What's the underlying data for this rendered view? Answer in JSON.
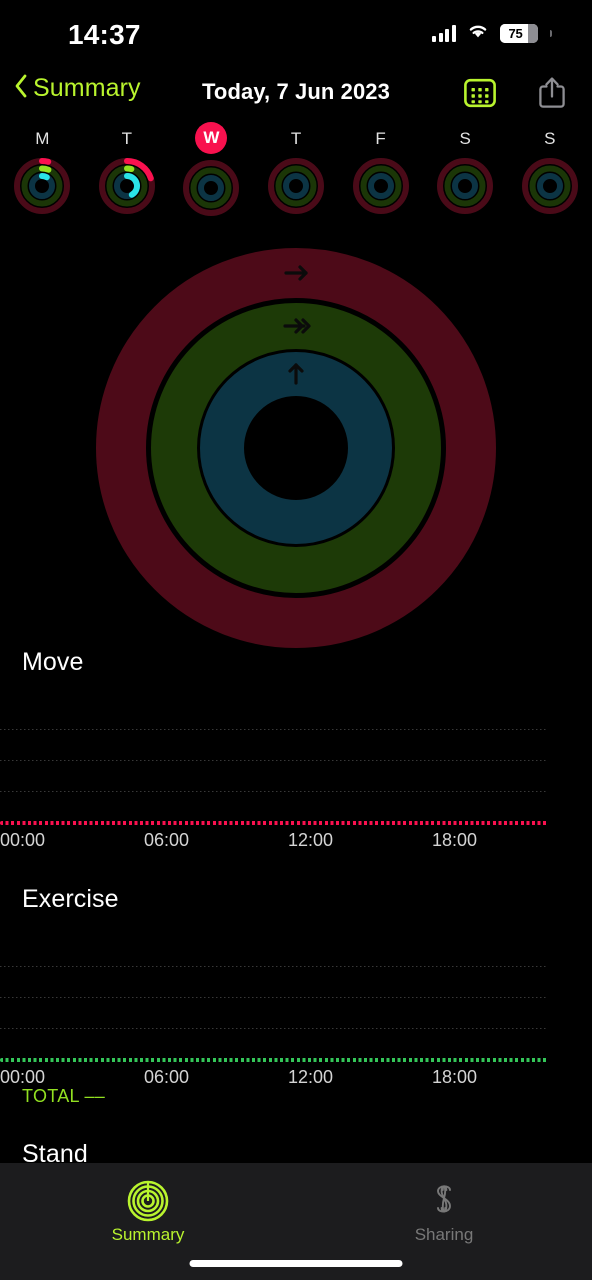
{
  "status_bar": {
    "time": "14:37",
    "cellular_icon": "cellular-bars-icon",
    "wifi_icon": "wifi-icon",
    "battery_level": "75",
    "battery_percent": 75
  },
  "nav_bar": {
    "back_icon": "chevron-left-icon",
    "back_label": "Summary",
    "title": "Today, 7 Jun 2023",
    "calendar_icon": "calendar-icon",
    "share_icon": "share-icon"
  },
  "week_strip": {
    "days": [
      {
        "label": "M",
        "is_today": false,
        "move_pct": 4,
        "exercise_pct": 6,
        "stand_pct": 8
      },
      {
        "label": "T",
        "is_today": false,
        "move_pct": 20,
        "exercise_pct": 4,
        "stand_pct": 42
      },
      {
        "label": "W",
        "is_today": true,
        "move_pct": 0,
        "exercise_pct": 0,
        "stand_pct": 0
      },
      {
        "label": "T",
        "is_today": false,
        "move_pct": 0,
        "exercise_pct": 0,
        "stand_pct": 0
      },
      {
        "label": "F",
        "is_today": false,
        "move_pct": 0,
        "exercise_pct": 0,
        "stand_pct": 0
      },
      {
        "label": "S",
        "is_today": false,
        "move_pct": 0,
        "exercise_pct": 0,
        "stand_pct": 0
      },
      {
        "label": "S",
        "is_today": false,
        "move_pct": 0,
        "exercise_pct": 0,
        "stand_pct": 0
      }
    ]
  },
  "main_rings": {
    "move": {
      "name": "Move",
      "progress_pct": 0,
      "icon": "arrow-right-icon",
      "color": "#fa114f",
      "track_color": "#4d0a18"
    },
    "exercise": {
      "name": "Exercise",
      "progress_pct": 0,
      "icon": "double-arrow-right-icon",
      "color": "#92e021",
      "track_color": "#1d3a07"
    },
    "stand": {
      "name": "Stand",
      "progress_pct": 0,
      "icon": "arrow-up-icon",
      "color": "#00d9e0",
      "track_color": "#0c3444"
    }
  },
  "charts": [
    {
      "title": "Move",
      "accent_color": "#fa114f",
      "axis_ticks": [
        "00:00",
        "06:00",
        "12:00",
        "18:00"
      ],
      "total_label": null,
      "chart_data": {
        "type": "bar",
        "title": "Move",
        "xlabel": "",
        "ylabel": "",
        "categories": [
          "00:00",
          "06:00",
          "12:00",
          "18:00"
        ],
        "values": [
          0,
          0,
          0,
          0
        ],
        "x": [
          "00:00",
          "06:00",
          "12:00",
          "18:00"
        ],
        "ylim": [
          0,
          4
        ],
        "gridlines": 3,
        "grid": true,
        "legend": "none",
        "series": [
          {
            "name": "Move",
            "values": [
              0,
              0,
              0,
              0
            ]
          }
        ]
      }
    },
    {
      "title": "Exercise",
      "accent_color": "#34c759",
      "axis_ticks": [
        "00:00",
        "06:00",
        "12:00",
        "18:00"
      ],
      "total_label": "TOTAL ––",
      "chart_data": {
        "type": "bar",
        "title": "Exercise",
        "xlabel": "",
        "ylabel": "",
        "categories": [
          "00:00",
          "06:00",
          "12:00",
          "18:00"
        ],
        "values": [
          0,
          0,
          0,
          0
        ],
        "x": [
          "00:00",
          "06:00",
          "12:00",
          "18:00"
        ],
        "ylim": [
          0,
          4
        ],
        "gridlines": 3,
        "grid": true,
        "legend": "none",
        "series": [
          {
            "name": "Exercise",
            "values": [
              0,
              0,
              0,
              0
            ]
          }
        ]
      }
    },
    {
      "title": "Stand",
      "accent_color": "#00d9e0",
      "axis_ticks": [],
      "total_label": null,
      "chart_data": {
        "type": "bar",
        "title": "Stand",
        "xlabel": "",
        "ylabel": "",
        "categories": [],
        "values": [],
        "grid": true,
        "legend": "none"
      }
    }
  ],
  "chart_data": [
    {
      "type": "bar",
      "title": "Move",
      "xlabel": "",
      "ylabel": "",
      "categories": [
        "00:00",
        "06:00",
        "12:00",
        "18:00"
      ],
      "values": [
        0,
        0,
        0,
        0
      ],
      "ylim": [
        0,
        4
      ],
      "grid": true,
      "legend": "none"
    },
    {
      "type": "bar",
      "title": "Exercise",
      "xlabel": "",
      "ylabel": "",
      "categories": [
        "00:00",
        "06:00",
        "12:00",
        "18:00"
      ],
      "values": [
        0,
        0,
        0,
        0
      ],
      "ylim": [
        0,
        4
      ],
      "grid": true,
      "legend": "none"
    }
  ],
  "tab_bar": {
    "tabs": [
      {
        "label": "Summary",
        "icon": "activity-rings-icon",
        "active": true
      },
      {
        "label": "Sharing",
        "icon": "sharing-s-icon",
        "active": false
      }
    ]
  }
}
